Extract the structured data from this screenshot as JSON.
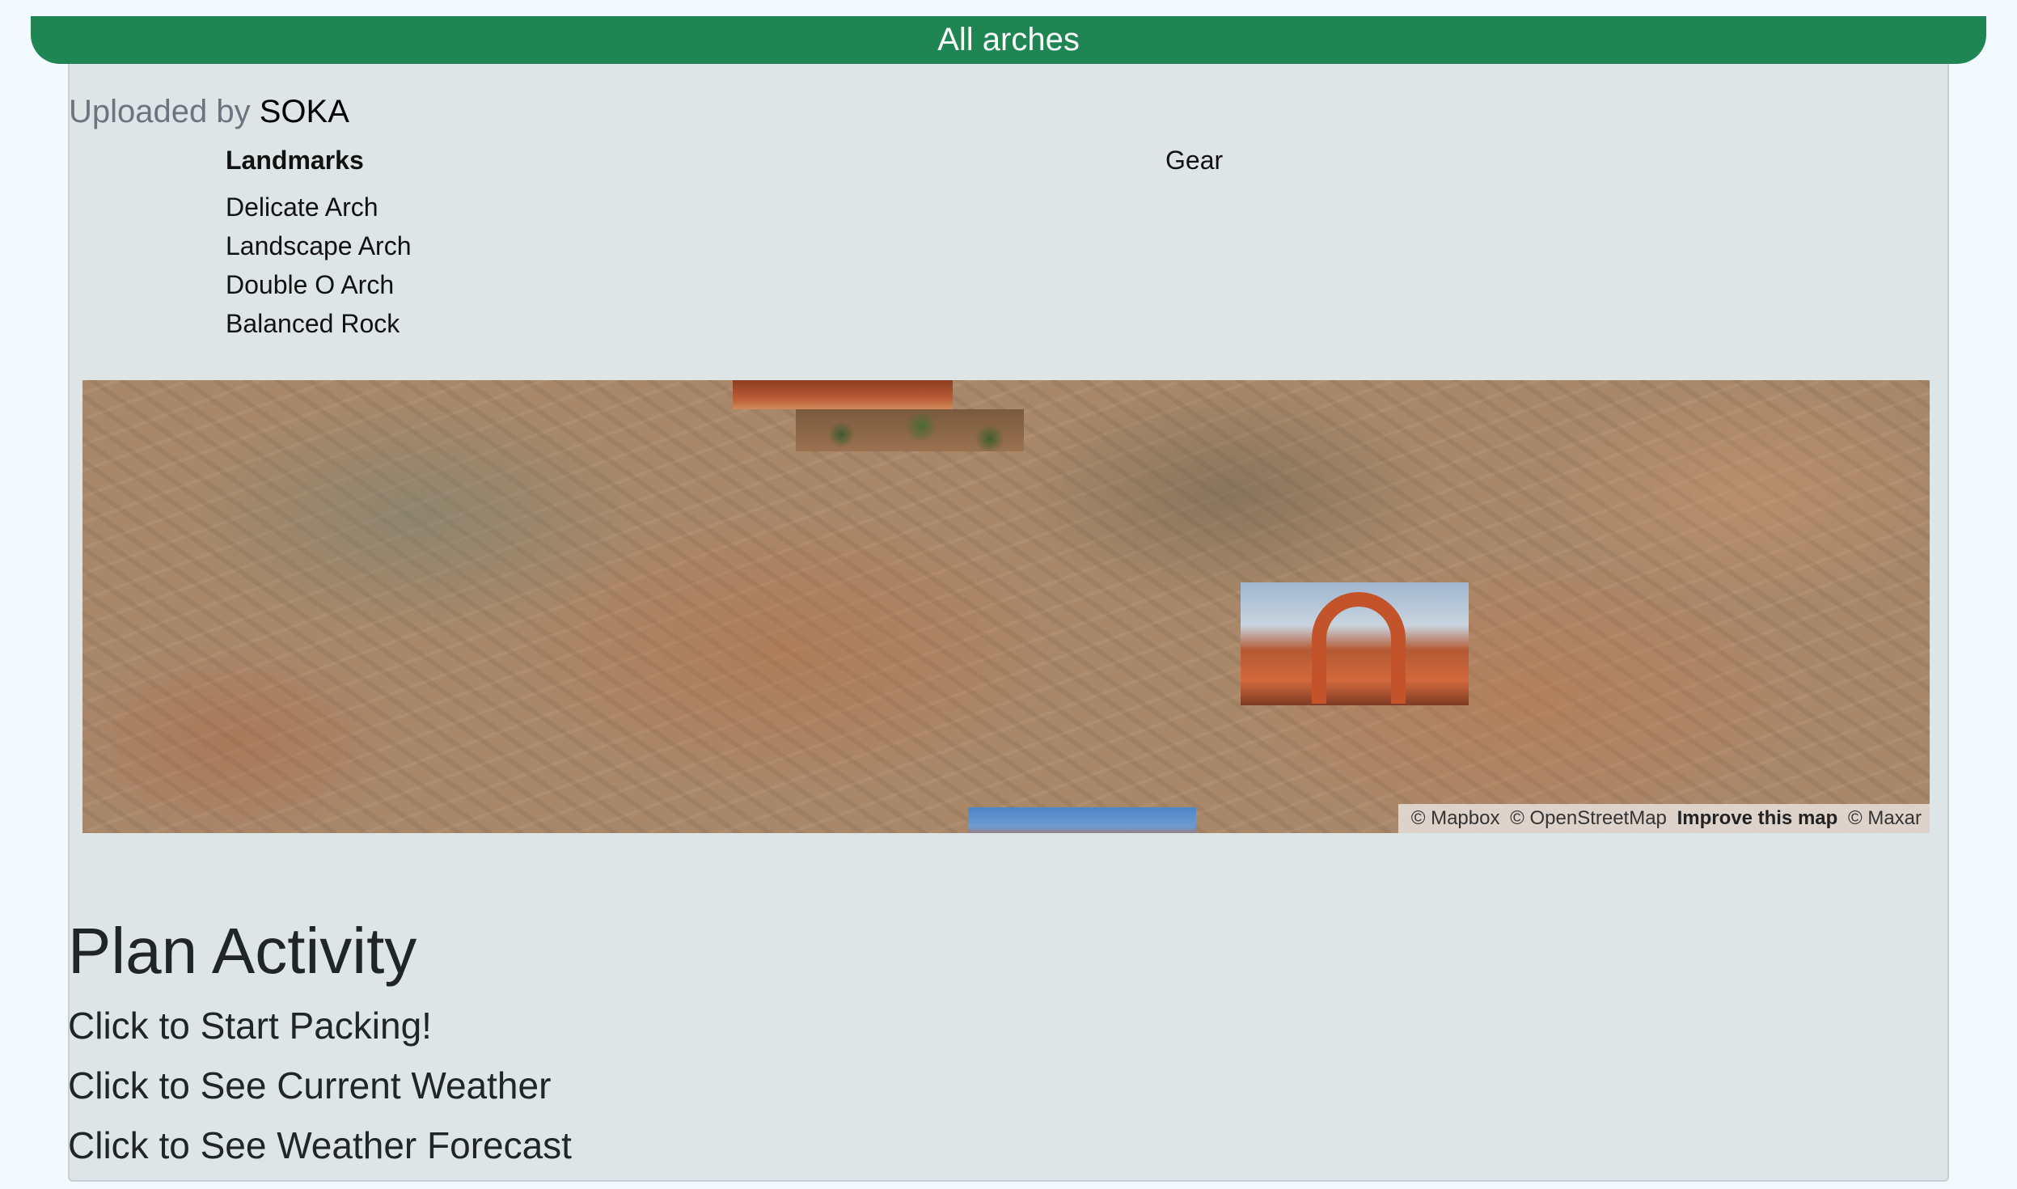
{
  "header": {
    "title": "All arches"
  },
  "uploader": {
    "label": "Uploaded by",
    "name": "SOKA"
  },
  "columns": {
    "landmarks_heading": "Landmarks",
    "gear_heading": "Gear",
    "landmarks": [
      "Delicate Arch",
      "Landscape Arch",
      "Double O Arch",
      "Balanced Rock"
    ]
  },
  "map": {
    "attribution": {
      "mapbox": "© Mapbox",
      "osm": "© OpenStreetMap",
      "improve": "Improve this map",
      "maxar": "© Maxar"
    }
  },
  "plan": {
    "title": "Plan Activity",
    "links": [
      "Click to Start Packing!",
      "Click to See Current Weather",
      "Click to See Weather Forecast"
    ]
  },
  "colors": {
    "header_bg": "#1e8553",
    "card_bg": "#dee5e6",
    "page_bg": "#f2f9ff"
  }
}
